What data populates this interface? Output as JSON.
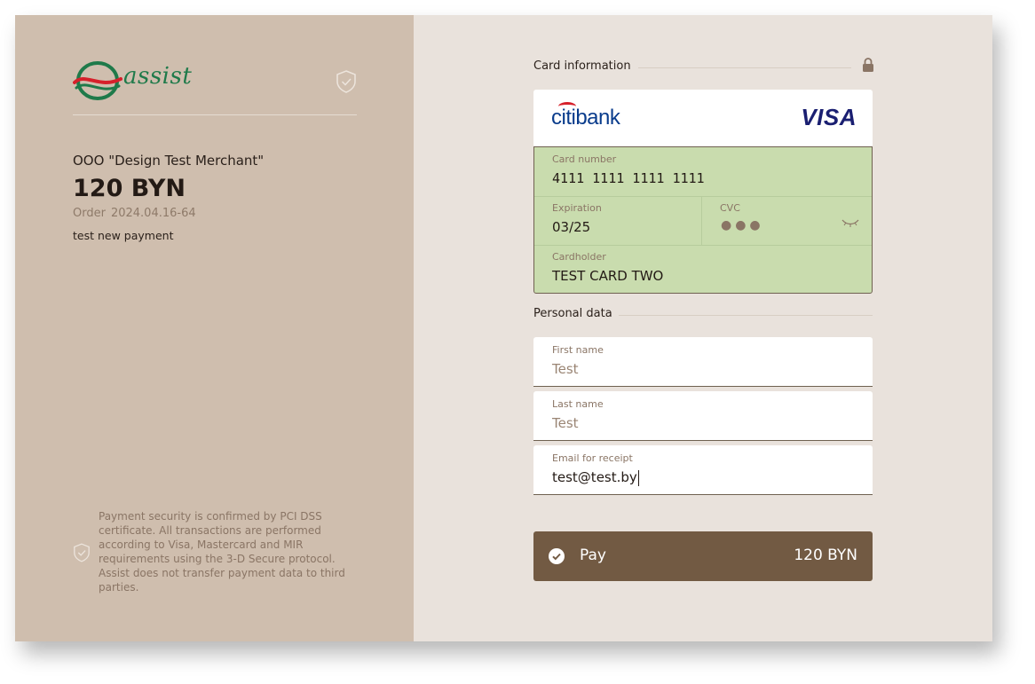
{
  "brand": {
    "logo_text": "assist",
    "colors": {
      "logo_green": "#1f7a4a",
      "logo_red": "#d6202b",
      "left_panel": "#cfbeae",
      "pay_button": "#725a43",
      "card_fill": "#c9dcae"
    }
  },
  "order": {
    "merchant": "OOO \"Design Test Merchant\"",
    "amount": "120 BYN",
    "order_label": "Order",
    "order_number": "2024.04.16-64",
    "description": "test new payment"
  },
  "security_note": "Payment security is confirmed by PCI DSS certificate. All transactions are performed according to Visa, Mastercard and MIR requirements using the 3-D Secure protocol. Assist does not transfer payment data to third parties.",
  "card_section": {
    "title": "Card information",
    "bank_name": "citibank",
    "network": "VISA",
    "card_number_label": "Card number",
    "card_number": "4111  1111  1111  1111",
    "expiration_label": "Expiration",
    "expiration": "03/25",
    "cvc_label": "CVC",
    "cvc_masked": "●●●",
    "cardholder_label": "Cardholder",
    "cardholder": "TEST CARD TWO"
  },
  "personal_section": {
    "title": "Personal data",
    "first_name_label": "First name",
    "first_name": "Test",
    "last_name_label": "Last name",
    "last_name": "Test",
    "email_label": "Email for receipt",
    "email": "test@test.by"
  },
  "pay_button": {
    "label": "Pay",
    "amount": "120 BYN"
  },
  "icons": [
    "assist-logo-icon",
    "shield-check-icon",
    "lock-icon",
    "eye-closed-icon",
    "check-circle-icon"
  ]
}
